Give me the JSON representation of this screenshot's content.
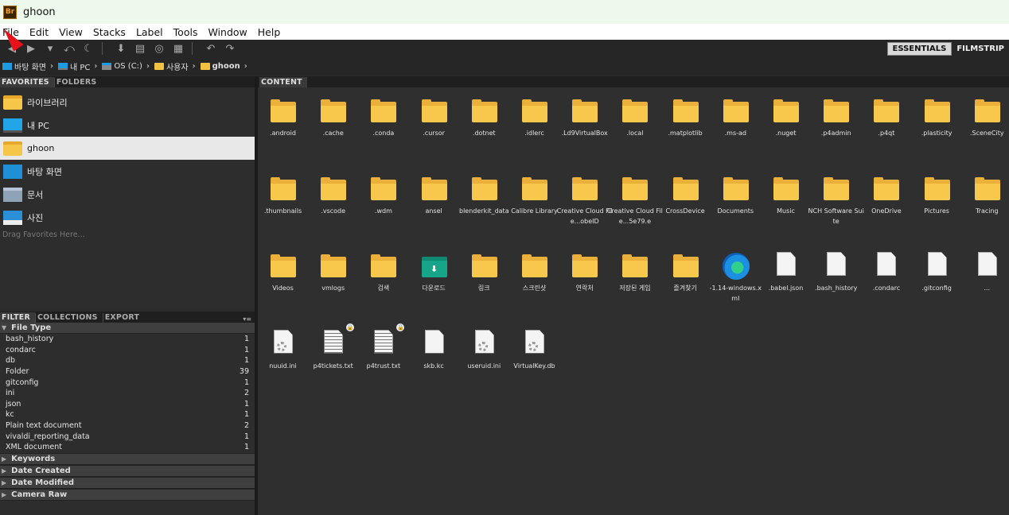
{
  "app": {
    "logo_text": "Br",
    "window_title": "ghoon"
  },
  "menu": [
    "File",
    "Edit",
    "View",
    "Stacks",
    "Label",
    "Tools",
    "Window",
    "Help"
  ],
  "workspaces": [
    "ESSENTIALS",
    "FILMSTRIP"
  ],
  "breadcrumb": [
    "바탕 화면",
    "내 PC",
    "OS (C:)",
    "사용자",
    "ghoon"
  ],
  "left_top": {
    "tabs": [
      "FAVORITES",
      "FOLDERS"
    ],
    "favorites": [
      {
        "label": "라이브러리",
        "icon": "library-folder"
      },
      {
        "label": "내 PC",
        "icon": "pc"
      },
      {
        "label": "ghoon",
        "icon": "user-folder",
        "selected": true
      },
      {
        "label": "바탕 화면",
        "icon": "desktop"
      },
      {
        "label": "문서",
        "icon": "documents"
      },
      {
        "label": "사진",
        "icon": "pictures"
      }
    ],
    "drag_hint": "Drag Favorites Here..."
  },
  "left_bottom": {
    "tabs": [
      "FILTER",
      "COLLECTIONS",
      "EXPORT"
    ],
    "file_type": {
      "title": "File Type",
      "rows": [
        {
          "name": "bash_history",
          "count": "1"
        },
        {
          "name": "condarc",
          "count": "1"
        },
        {
          "name": "db",
          "count": "1"
        },
        {
          "name": "Folder",
          "count": "39"
        },
        {
          "name": "gitconfig",
          "count": "1"
        },
        {
          "name": "ini",
          "count": "2"
        },
        {
          "name": "json",
          "count": "1"
        },
        {
          "name": "kc",
          "count": "1"
        },
        {
          "name": "Plain text document",
          "count": "2"
        },
        {
          "name": "vivaldi_reporting_data",
          "count": "1"
        },
        {
          "name": "XML document",
          "count": "1"
        }
      ]
    },
    "collapsed_sections": [
      "Keywords",
      "Date Created",
      "Date Modified",
      "Camera Raw"
    ]
  },
  "content": {
    "tab": "CONTENT",
    "items": [
      {
        "label": ".android",
        "icon": "folder"
      },
      {
        "label": ".cache",
        "icon": "folder"
      },
      {
        "label": ".conda",
        "icon": "folder"
      },
      {
        "label": ".cursor",
        "icon": "folder"
      },
      {
        "label": ".dotnet",
        "icon": "folder"
      },
      {
        "label": ".idlerc",
        "icon": "folder"
      },
      {
        "label": ".Ld9VirtualBox",
        "icon": "folder"
      },
      {
        "label": ".local",
        "icon": "folder"
      },
      {
        "label": ".matplotlib",
        "icon": "folder"
      },
      {
        "label": ".ms-ad",
        "icon": "folder"
      },
      {
        "label": ".nuget",
        "icon": "folder"
      },
      {
        "label": ".p4admin",
        "icon": "folder"
      },
      {
        "label": ".p4qt",
        "icon": "folder"
      },
      {
        "label": ".plasticity",
        "icon": "folder"
      },
      {
        "label": ".SceneCity",
        "icon": "folder"
      },
      {
        "label": ".thumbnails",
        "icon": "folder"
      },
      {
        "label": ".vscode",
        "icon": "folder"
      },
      {
        "label": ".wdm",
        "icon": "folder"
      },
      {
        "label": "ansel",
        "icon": "folder"
      },
      {
        "label": "blenderkit_data",
        "icon": "folder"
      },
      {
        "label": "Calibre Library",
        "icon": "folder"
      },
      {
        "label": "Creative Cloud File...obeID",
        "icon": "folder"
      },
      {
        "label": "Creative Cloud File...5e79.e",
        "icon": "folder"
      },
      {
        "label": "CrossDevice",
        "icon": "folder"
      },
      {
        "label": "Documents",
        "icon": "folder"
      },
      {
        "label": "Music",
        "icon": "folder"
      },
      {
        "label": "NCH Software Suite",
        "icon": "folder"
      },
      {
        "label": "OneDrive",
        "icon": "folder"
      },
      {
        "label": "Pictures",
        "icon": "folder"
      },
      {
        "label": "Tracing",
        "icon": "folder"
      },
      {
        "label": "Videos",
        "icon": "folder"
      },
      {
        "label": "vmlogs",
        "icon": "folder"
      },
      {
        "label": "검색",
        "icon": "folder"
      },
      {
        "label": "다운로드",
        "icon": "download-folder"
      },
      {
        "label": "링크",
        "icon": "folder"
      },
      {
        "label": "스크린샷",
        "icon": "folder"
      },
      {
        "label": "연락처",
        "icon": "folder"
      },
      {
        "label": "저장된 게임",
        "icon": "folder"
      },
      {
        "label": "즐겨찾기",
        "icon": "folder"
      },
      {
        "label": "-1.14-windows.xml",
        "icon": "edge"
      },
      {
        "label": ".babel.json",
        "icon": "document"
      },
      {
        "label": ".bash_history",
        "icon": "document"
      },
      {
        "label": ".condarc",
        "icon": "document"
      },
      {
        "label": ".gitconfig",
        "icon": "document"
      },
      {
        "label": "...",
        "icon": "document"
      },
      {
        "label": "nuuid.ini",
        "icon": "settings-document"
      },
      {
        "label": "p4tickets.txt",
        "icon": "text-document",
        "locked": true
      },
      {
        "label": "p4trust.txt",
        "icon": "text-document",
        "locked": true
      },
      {
        "label": "skb.kc",
        "icon": "document"
      },
      {
        "label": "useruid.ini",
        "icon": "settings-document"
      },
      {
        "label": "VirtualKey.db",
        "icon": "settings-document"
      }
    ]
  }
}
